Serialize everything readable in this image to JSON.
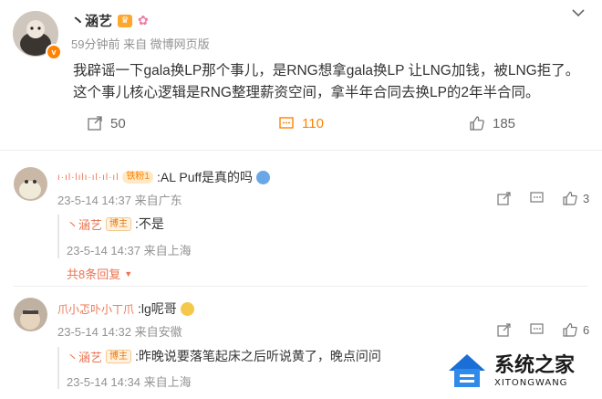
{
  "post": {
    "author": "丶涵艺",
    "time_source": "59分钟前  来自 微博网页版",
    "text_line1": "我辟谣一下gala换LP那个事儿，是RNG想拿gala换LP 让LNG加钱，被LNG拒了。",
    "text_line2": "这个事儿核心逻辑是RNG整理薪资空间，拿半年合同去换LP的2年半合同。",
    "actions": {
      "share": "50",
      "comment": "110",
      "like": "185"
    }
  },
  "comments": [
    {
      "user": "ı·ıl·lılı·ıl·ıl·ıl",
      "badge": "铁粉1",
      "text": ":AL Puff是真的吗",
      "meta": "23-5-14 14:37 来自广东",
      "likes": "3",
      "reply": {
        "user": "丶涵艺",
        "badge": "博主",
        "text": ":不是",
        "meta": "23-5-14 14:37 来自上海"
      },
      "more_replies": "共8条回复"
    },
    {
      "user": "爪小忑卟小丅爪",
      "text": ":lg呢哥",
      "meta": "23-5-14 14:32 来自安徽",
      "likes": "6",
      "reply": {
        "user": "丶涵艺",
        "badge": "博主",
        "text": ":昨晚说要落笔起床之后听说黄了，晚点问问",
        "meta": "23-5-14 14:34 来自上海"
      }
    }
  ],
  "watermark": {
    "title": "系统之家",
    "sub": "XITONGWANG"
  },
  "colors": {
    "accent": "#ff8200",
    "name": "#eb7350"
  }
}
